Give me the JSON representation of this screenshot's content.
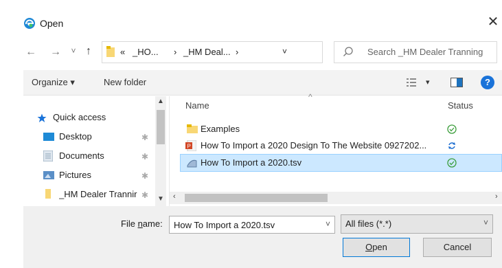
{
  "window": {
    "title": "Open",
    "close_label": "✕"
  },
  "nav": {
    "back": "←",
    "forward": "→",
    "recent": "˅",
    "up": "↑",
    "breadcrumb": [
      "«",
      "_HO...",
      "›",
      "_HM Deal...",
      "›"
    ],
    "dropdown": "˅",
    "refresh": "↻"
  },
  "search": {
    "placeholder": "Search _HM Dealer Tranning"
  },
  "toolbar": {
    "organize_label": "Organize ▾",
    "new_folder_label": "New folder",
    "view_arrow": "▾",
    "help_label": "?"
  },
  "sidebar": {
    "items": [
      {
        "label": "Quick access",
        "icon": "star-icon"
      },
      {
        "label": "Desktop",
        "icon": "desktop-folder-icon",
        "pinned": true
      },
      {
        "label": "Documents",
        "icon": "documents-folder-icon",
        "pinned": true
      },
      {
        "label": "Pictures",
        "icon": "pictures-folder-icon",
        "pinned": true
      },
      {
        "label": "_HM Dealer Trannir",
        "icon": "folder-icon",
        "pinned": true
      }
    ],
    "pin_glyph": "📌"
  },
  "files": {
    "columns": {
      "name": "Name",
      "status": "Status",
      "sort_indicator": "^"
    },
    "rows": [
      {
        "name": "Examples",
        "icon": "folder-icon",
        "status": "synced",
        "selected": false
      },
      {
        "name": "How To Import a 2020 Design To The Website 0927202...",
        "icon": "powerpoint-icon",
        "status": "syncing",
        "selected": false
      },
      {
        "name": "How To Import a 2020.tsv",
        "icon": "tsv-file-icon",
        "status": "synced",
        "selected": true
      }
    ]
  },
  "footer": {
    "filename_label_pre": "File ",
    "filename_label_u": "n",
    "filename_label_post": "ame:",
    "filename_value": "How To Import a 2020.tsv",
    "filetype_value": "All files (*.*)",
    "open_label_u": "O",
    "open_label_post": "pen",
    "cancel_label": "Cancel"
  },
  "colors": {
    "accent": "#0078d7",
    "selection": "#cce8ff",
    "folder": "#f8d775",
    "sync_green": "#3a9d3a",
    "sync_blue": "#1f6fd1"
  }
}
